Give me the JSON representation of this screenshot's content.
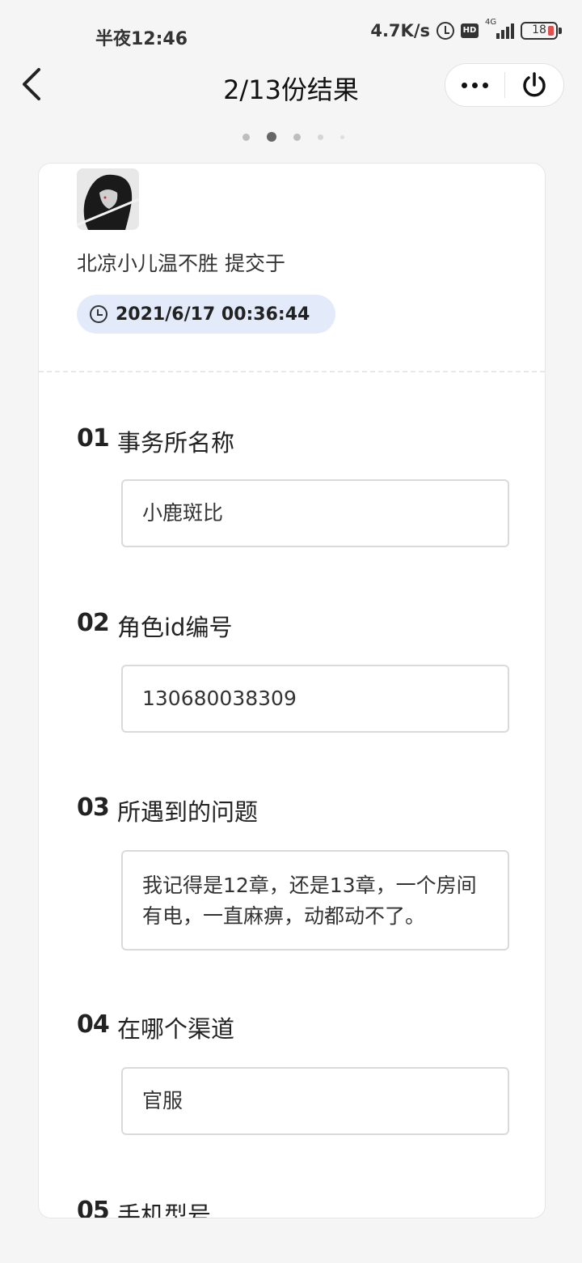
{
  "status_bar": {
    "time": "半夜12:46",
    "speed": "4.7K/s",
    "network": "4G",
    "hd_label": "HD",
    "battery": "18"
  },
  "nav": {
    "title": "2/13份结果"
  },
  "pager": {
    "count": 5,
    "active_index": 1
  },
  "submission": {
    "submitter_line": "北凉小儿温不胜 提交于",
    "submitted_at": "2021/6/17 00:36:44"
  },
  "questions": [
    {
      "num": "01",
      "label": "事务所名称",
      "answer": "小鹿斑比"
    },
    {
      "num": "02",
      "label": "角色id编号",
      "answer": "130680038309"
    },
    {
      "num": "03",
      "label": "所遇到的问题",
      "answer": "我记得是12章，还是13章，一个房间有电，一直麻痹，动都动不了。"
    },
    {
      "num": "04",
      "label": "在哪个渠道",
      "answer": "官服"
    },
    {
      "num": "05",
      "label": "手机型号"
    }
  ],
  "colors": {
    "time_pill_bg": "#e3ebfb",
    "battery_low": "#e0504f"
  }
}
